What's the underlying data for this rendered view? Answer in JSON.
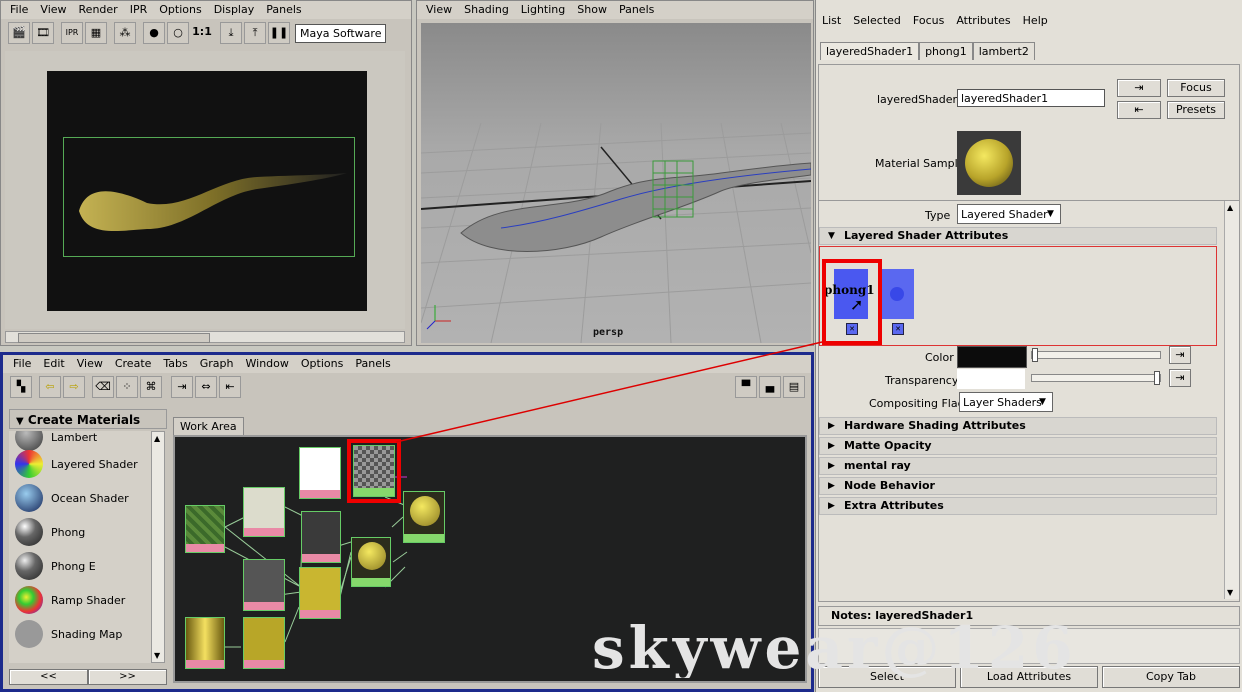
{
  "render_view": {
    "menu": [
      "File",
      "View",
      "Render",
      "IPR",
      "Options",
      "Display",
      "Panels"
    ],
    "toolbar_ratio": "1:1",
    "renderer": "Maya Software"
  },
  "viewport": {
    "menu": [
      "View",
      "Shading",
      "Lighting",
      "Show",
      "Panels"
    ],
    "camera_label": "persp"
  },
  "attribute_editor": {
    "menu": [
      "List",
      "Selected",
      "Focus",
      "Attributes",
      "Help"
    ],
    "tabs": [
      "layeredShader1",
      "phong1",
      "lambert2"
    ],
    "shader_label": "layeredShader:",
    "shader_name": "layeredShader1",
    "focus_btn": "Focus",
    "presets_btn": "Presets",
    "material_sample_label": "Material Sample",
    "type_label": "Type",
    "type_value": "Layered Shader",
    "layered_section": "Layered Shader Attributes",
    "layer_swatch_label": "phong1",
    "color_label": "Color",
    "transparency_label": "Transparency",
    "compositing_label": "Compositing Flag",
    "compositing_value": "Layer Shaders",
    "sections": [
      "Hardware Shading Attributes",
      "Matte Opacity",
      "mental ray",
      "Node Behavior",
      "Extra Attributes"
    ],
    "notes": "Notes: layeredShader1",
    "bottom_buttons": [
      "Select",
      "Load Attributes",
      "Copy Tab"
    ]
  },
  "hypershade": {
    "menu": [
      "File",
      "Edit",
      "View",
      "Create",
      "Tabs",
      "Graph",
      "Window",
      "Options",
      "Panels"
    ],
    "create_title": "Create Materials",
    "materials": [
      "Lambert",
      "Layered Shader",
      "Ocean Shader",
      "Phong",
      "Phong E",
      "Ramp Shader",
      "Shading Map"
    ],
    "work_area_tab": "Work Area",
    "scroll_left": "<<",
    "scroll_right": ">>"
  },
  "watermark": "skywear@126"
}
